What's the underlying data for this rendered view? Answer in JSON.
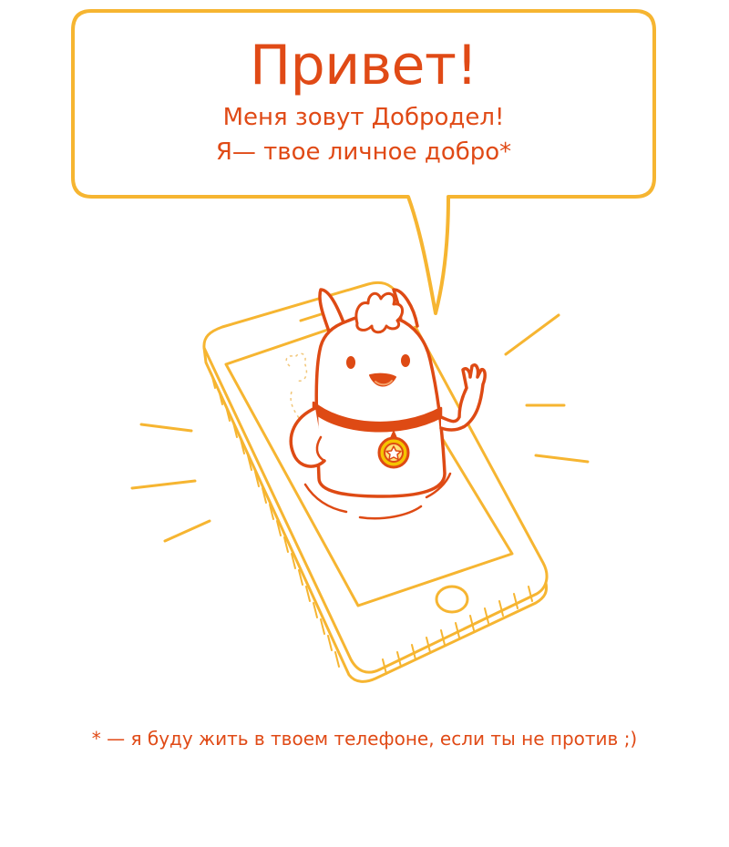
{
  "bubble": {
    "greeting": "Привет!",
    "line1": "Меня зовут Добродел!",
    "line2": "Я— твое личное добро*"
  },
  "footnote": "* — я буду жить в твоем телефоне, если ты не против ;)",
  "colors": {
    "text": "#e04a16",
    "outline": "#f6b531",
    "character_outline": "#de4a14",
    "medal": "#f5c400"
  },
  "icons": {
    "illustration": "mascot-in-phone-illustration",
    "bubble": "speech-bubble"
  }
}
